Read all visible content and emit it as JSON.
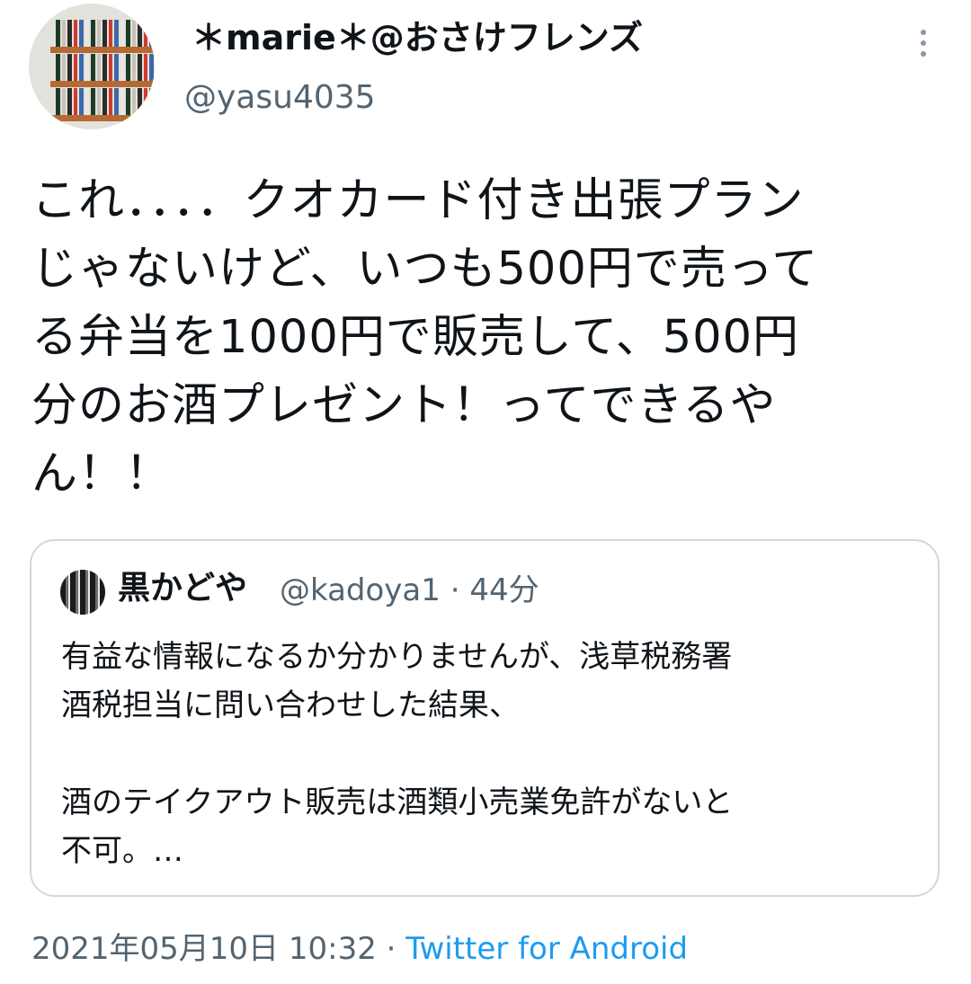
{
  "tweet": {
    "display_name": "＊marie＊@おさけフレンズ",
    "handle": "@yasu4035",
    "text": "これ．．．．クオカード付き出張プラン\nじゃないけど、いつも500円で売って\nる弁当を1000円で販売して、500円\n分のお酒プレゼント！ってできるや\nん！！",
    "timestamp": "2021年05月10日 10:32",
    "separator": " · ",
    "source": "Twitter for Android"
  },
  "quote": {
    "display_name": "黒かどや",
    "handle": "@kadoya1",
    "separator": " · ",
    "time_ago": "44分",
    "text": "有益な情報になるか分かりませんが、浅草税務署\n酒税担当に問い合わせした結果、\n\n酒のテイクアウト販売は酒類小売業免許がないと\n不可。…"
  },
  "colors": {
    "text": "#0f1419",
    "secondary": "#536471",
    "link": "#1d9bf0",
    "border": "#cfd9de"
  },
  "icons": {
    "more": "more-vertical-icon"
  }
}
